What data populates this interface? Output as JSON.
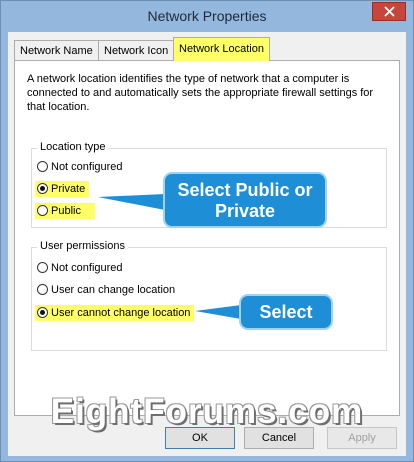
{
  "window": {
    "title": "Network Properties"
  },
  "tabs": [
    {
      "label": "Network Name"
    },
    {
      "label": "Network Icon"
    },
    {
      "label": "Network Location"
    }
  ],
  "description": "A network location identifies the type of network that a computer is connected to and automatically sets the appropriate firewall settings for that location.",
  "location_type": {
    "legend": "Location type",
    "options": [
      {
        "label": "Not configured",
        "checked": false
      },
      {
        "label": "Private",
        "checked": true
      },
      {
        "label": "Public",
        "checked": false
      }
    ]
  },
  "user_permissions": {
    "legend": "User permissions",
    "options": [
      {
        "label": "Not configured",
        "checked": false
      },
      {
        "label": "User can change location",
        "checked": false
      },
      {
        "label": "User cannot change location",
        "checked": true
      }
    ]
  },
  "callouts": {
    "location": "Select Public or Private",
    "permissions": "Select"
  },
  "watermark": "EightForums.com",
  "buttons": {
    "ok": "OK",
    "cancel": "Cancel",
    "apply": "Apply"
  },
  "colors": {
    "highlight": "#ffff66",
    "callout": "#1e8fd6",
    "titlebar": "#93b7dd"
  }
}
